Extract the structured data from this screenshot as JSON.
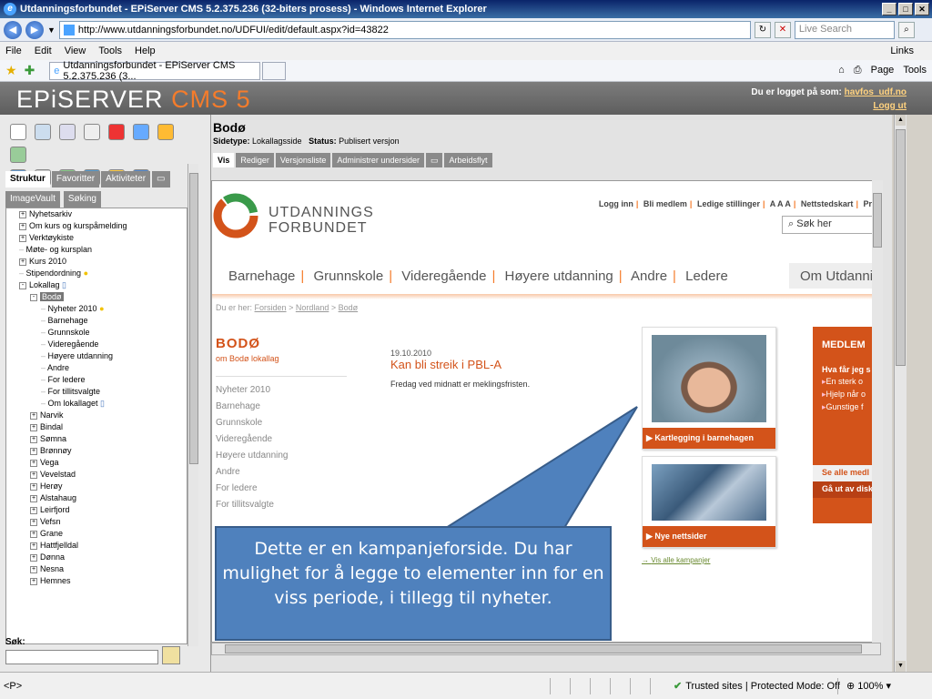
{
  "browser": {
    "window_title": "Utdanningsforbundet - EPiServer CMS 5.2.375.236 (32-biters prosess) - Windows Internet Explorer",
    "url": "http://www.utdanningsforbundet.no/UDFUI/edit/default.aspx?id=43822",
    "search_placeholder": "Live Search",
    "menu": [
      "File",
      "Edit",
      "View",
      "Tools",
      "Help"
    ],
    "links_label": "Links",
    "tab_title": "Utdanningsforbundet - EPiServer CMS 5.2.375.236 (3...",
    "page_label": "Page",
    "tools_label": "Tools"
  },
  "episerver": {
    "logo_text": "EPiSERVER",
    "logo_cms": "CMS 5",
    "logged_in_label": "Du er logget på som:",
    "username": "havfos_udf.no",
    "logout": "Logg ut"
  },
  "left_pane": {
    "tabs": [
      "Struktur",
      "Favoritter",
      "Aktiviteter"
    ],
    "tabs2": [
      "ImageVault",
      "Søking"
    ],
    "search_label": "Søk:",
    "tree": [
      {
        "label": "Nyhetsarkiv",
        "level": 1,
        "exp": "+"
      },
      {
        "label": "Om kurs og kurspåmelding",
        "level": 1,
        "exp": "+"
      },
      {
        "label": "Verktøykiste",
        "level": 1,
        "exp": "+"
      },
      {
        "label": "Møte- og kursplan",
        "level": 1,
        "exp": ""
      },
      {
        "label": "Kurs 2010",
        "level": 1,
        "exp": "+"
      },
      {
        "label": "Stipendordning",
        "level": 1,
        "exp": "",
        "icon": "bulb"
      },
      {
        "label": "Lokallag",
        "level": 1,
        "exp": "-",
        "icon": "doc"
      },
      {
        "label": "Bodø",
        "level": 2,
        "exp": "-",
        "selected": true
      },
      {
        "label": "Nyheter 2010",
        "level": 3,
        "exp": "",
        "icon": "bulb"
      },
      {
        "label": "Barnehage",
        "level": 3,
        "exp": ""
      },
      {
        "label": "Grunnskole",
        "level": 3,
        "exp": ""
      },
      {
        "label": "Videregående",
        "level": 3,
        "exp": ""
      },
      {
        "label": "Høyere utdanning",
        "level": 3,
        "exp": ""
      },
      {
        "label": "Andre",
        "level": 3,
        "exp": ""
      },
      {
        "label": "For ledere",
        "level": 3,
        "exp": ""
      },
      {
        "label": "For tillitsvalgte",
        "level": 3,
        "exp": ""
      },
      {
        "label": "Om lokallaget",
        "level": 3,
        "exp": "",
        "icon": "doc"
      },
      {
        "label": "Narvik",
        "level": 2,
        "exp": "+"
      },
      {
        "label": "Bindal",
        "level": 2,
        "exp": "+"
      },
      {
        "label": "Sømna",
        "level": 2,
        "exp": "+"
      },
      {
        "label": "Brønnøy",
        "level": 2,
        "exp": "+"
      },
      {
        "label": "Vega",
        "level": 2,
        "exp": "+"
      },
      {
        "label": "Vevelstad",
        "level": 2,
        "exp": "+"
      },
      {
        "label": "Herøy",
        "level": 2,
        "exp": "+"
      },
      {
        "label": "Alstahaug",
        "level": 2,
        "exp": "+"
      },
      {
        "label": "Leirfjord",
        "level": 2,
        "exp": "+"
      },
      {
        "label": "Vefsn",
        "level": 2,
        "exp": "+"
      },
      {
        "label": "Grane",
        "level": 2,
        "exp": "+"
      },
      {
        "label": "Hattfjelldal",
        "level": 2,
        "exp": "+"
      },
      {
        "label": "Dønna",
        "level": 2,
        "exp": "+"
      },
      {
        "label": "Nesna",
        "level": 2,
        "exp": "+"
      },
      {
        "label": "Hemnes",
        "level": 2,
        "exp": "+"
      }
    ]
  },
  "edit_pane": {
    "page_title": "Bodø",
    "sidetype_label": "Sidetype:",
    "sidetype_value": "Lokallagsside",
    "status_label": "Status:",
    "status_value": "Publisert versjon",
    "tabs": [
      "Vis",
      "Rediger",
      "Versjonsliste",
      "Administrer undersider",
      "Arbeidsflyt"
    ]
  },
  "site": {
    "org_line1": "UTDANNINGS",
    "org_line2": "FORBUNDET",
    "top_links": [
      "Logg inn",
      "Bli medlem",
      "Ledige stillinger",
      "A A A",
      "Nettstedskart",
      "Pre"
    ],
    "search_placeholder": "Søk her",
    "nav": [
      "Barnehage",
      "Grunnskole",
      "Videregående",
      "Høyere utdanning",
      "Andre",
      "Ledere"
    ],
    "nav_last": "Om Utdannings",
    "breadcrumb_prefix": "Du er her:",
    "breadcrumb": [
      "Forsiden",
      "Nordland",
      "Bodø"
    ],
    "section_title": "BODØ",
    "section_sub": "om Bodø lokallag",
    "side_nav": [
      "Nyheter 2010",
      "Barnehage",
      "Grunnskole",
      "Videregående",
      "Høyere utdanning",
      "Andre",
      "For ledere",
      "For tillitsvalgte"
    ],
    "news_date": "19.10.2010",
    "news_title": "Kan bli streik i PBL-A",
    "news_text": "Fredag ved midnatt er meklingsfristen.",
    "campaign1": "Kartlegging i barnehagen",
    "campaign2": "Nye nettsider",
    "all_campaigns": "Vis alle kampanjer",
    "medlem_title": "MEDLEM",
    "medlem_question": "Hva får jeg s",
    "medlem_bullets": [
      "En sterk o",
      "Hjelp når o",
      "Gunstige f"
    ],
    "se_alle": "Se alle medl",
    "ga_ut": "Gå ut av disk"
  },
  "callout": {
    "text": "Dette er en kampanjeforside. Du har mulighet for å legge to elementer inn for en viss periode, i tillegg til nyheter."
  },
  "status_bar": {
    "left": "<P>",
    "trusted": "Trusted sites | Protected Mode: Off",
    "zoom": "100%"
  }
}
